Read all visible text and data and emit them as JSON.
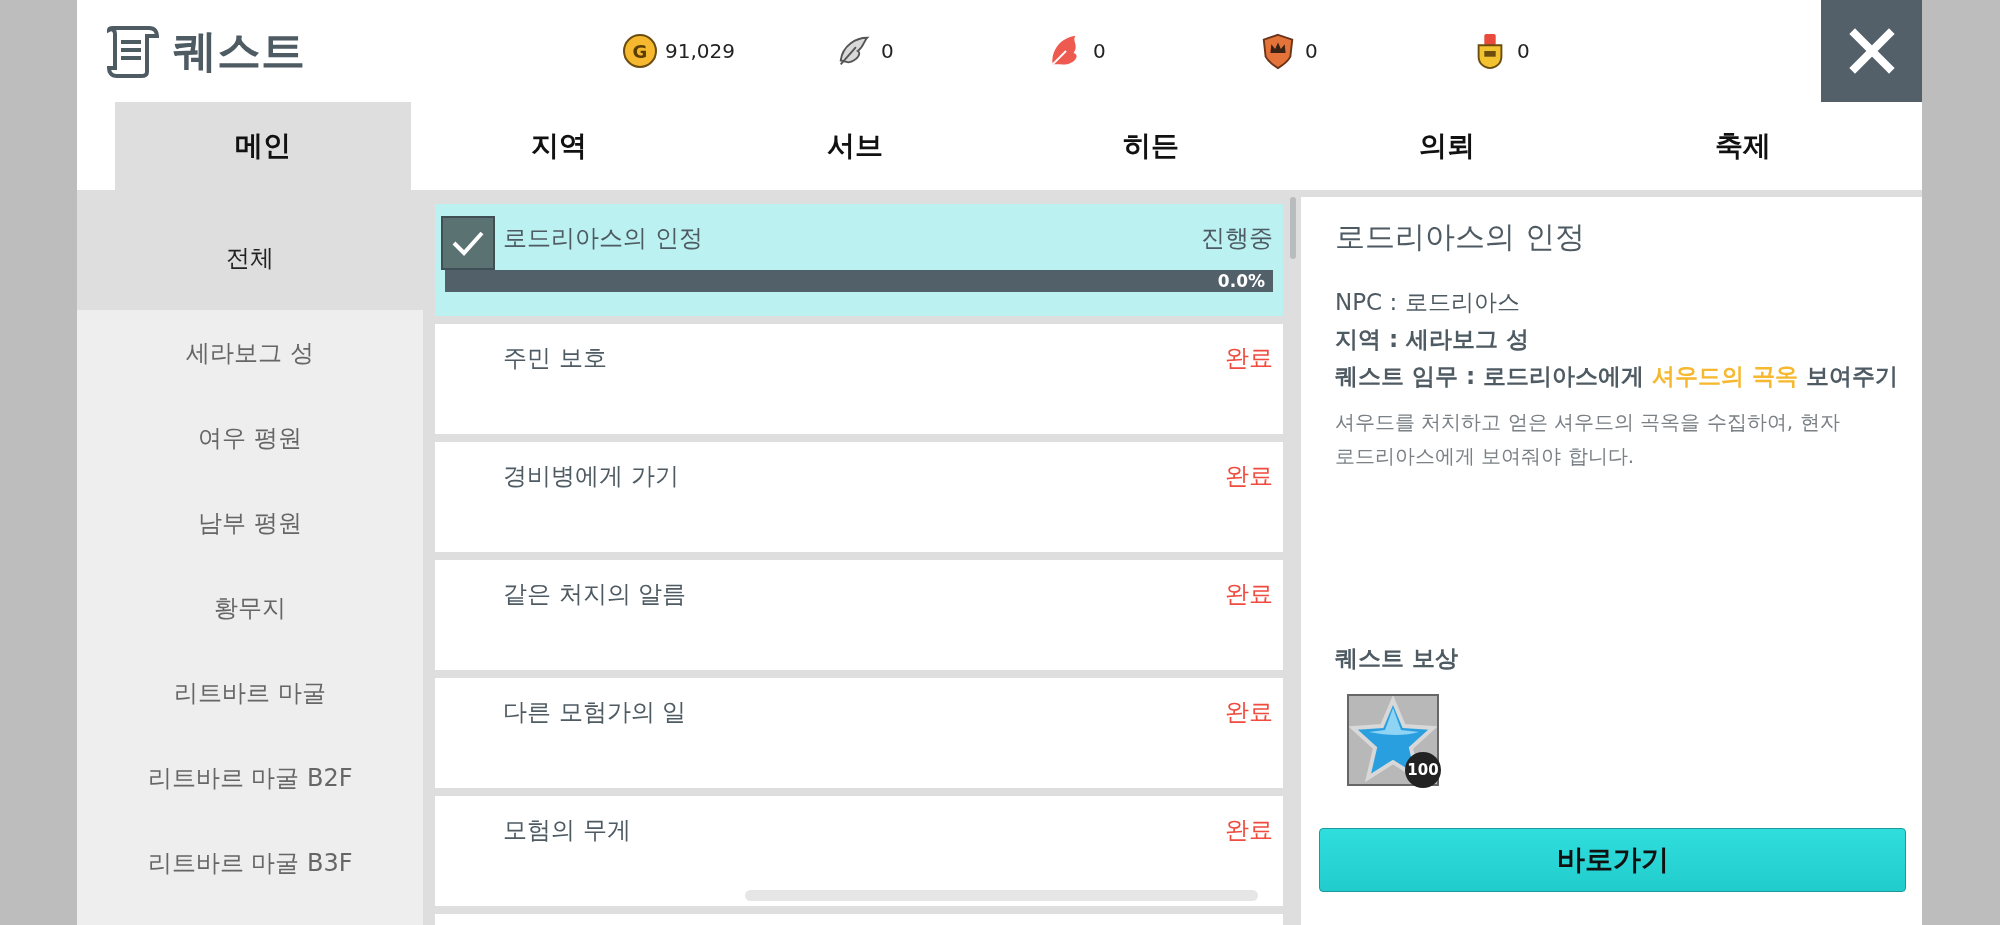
{
  "header": {
    "title": "퀘스트",
    "currencies": [
      {
        "kind": "coin",
        "symbol": "G",
        "amount": "91,029"
      },
      {
        "kind": "feather",
        "amount": "0"
      },
      {
        "kind": "leaf",
        "amount": "0"
      },
      {
        "kind": "crest",
        "amount": "0"
      },
      {
        "kind": "medal",
        "amount": "0"
      }
    ]
  },
  "tabs": [
    {
      "label": "메인",
      "selected": true
    },
    {
      "label": "지역",
      "selected": false
    },
    {
      "label": "서브",
      "selected": false
    },
    {
      "label": "히든",
      "selected": false
    },
    {
      "label": "의뢰",
      "selected": false
    },
    {
      "label": "축제",
      "selected": false
    }
  ],
  "categories": [
    {
      "label": "전체",
      "selected": true
    },
    {
      "label": "세라보그 성",
      "selected": false
    },
    {
      "label": "여우 평원",
      "selected": false
    },
    {
      "label": "남부 평원",
      "selected": false
    },
    {
      "label": "황무지",
      "selected": false
    },
    {
      "label": "리트바르 마굴",
      "selected": false
    },
    {
      "label": "리트바르 마굴 B2F",
      "selected": false
    },
    {
      "label": "리트바르 마굴 B3F",
      "selected": false
    }
  ],
  "quests": [
    {
      "name": "로드리아스의 인정",
      "status": "진행중",
      "completed": false,
      "selected": true,
      "checked": true,
      "progress": {
        "level": 0,
        "reading": "0.0%"
      }
    },
    {
      "name": "주민 보호",
      "status": "완료",
      "completed": true,
      "selected": false,
      "checked": false
    },
    {
      "name": "경비병에게 가기",
      "status": "완료",
      "completed": true,
      "selected": false,
      "checked": false
    },
    {
      "name": "같은 처지의 알름",
      "status": "완료",
      "completed": true,
      "selected": false,
      "checked": false
    },
    {
      "name": "다른 모험가의 일",
      "status": "완료",
      "completed": true,
      "selected": false,
      "checked": false
    },
    {
      "name": "모험의 무게",
      "status": "완료",
      "completed": true,
      "selected": false,
      "checked": false
    }
  ],
  "detail": {
    "title": "로드리아스의 인정",
    "npc": "NPC : 로드리아스",
    "region": "지역 : 세라보그 성",
    "mission": "퀘스트 임무 : 로드리아스에게 **셔우드의 곡옥** 보여주기",
    "description": "셔우드를 처치하고 얻은 셔우드의 곡옥을 수집하여, 현자 로드리아스에게 보여줘야 합니다.",
    "reward_heading": "퀘스트 보상",
    "rewards": [
      {
        "kind": "star",
        "count": "100"
      }
    ],
    "go_button": "바로가기"
  }
}
